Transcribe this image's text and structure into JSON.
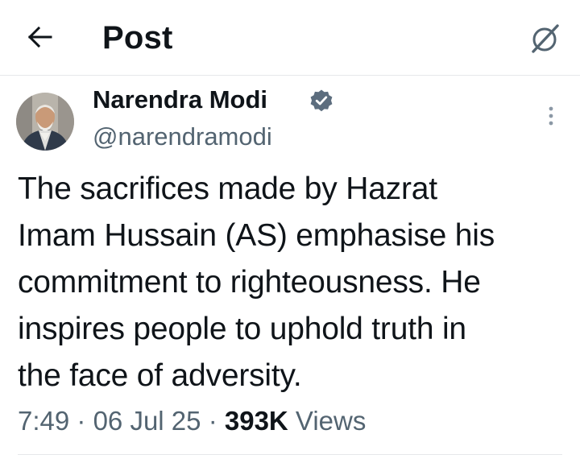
{
  "header": {
    "title": "Post",
    "back_icon": "arrow-left-icon",
    "grok_icon": "grok-icon"
  },
  "author": {
    "name": "Narendra Modi",
    "handle": "@narendramodi",
    "verified": true,
    "verified_color": "#1d9bf0"
  },
  "post": {
    "lines": [
      "The sacrifices made by Hazrat",
      "Imam Hussain (AS) emphasise his",
      "commitment to righteousness. He",
      "inspires people to uphold truth in",
      "the face of adversity."
    ]
  },
  "meta": {
    "time": "7:49",
    "separator": "·",
    "date": "06 Jul 25",
    "views_count": "393K",
    "views_label": "Views"
  },
  "colors": {
    "text_primary": "#0f1419",
    "text_secondary": "#536471",
    "divider": "#e6e8ea"
  }
}
